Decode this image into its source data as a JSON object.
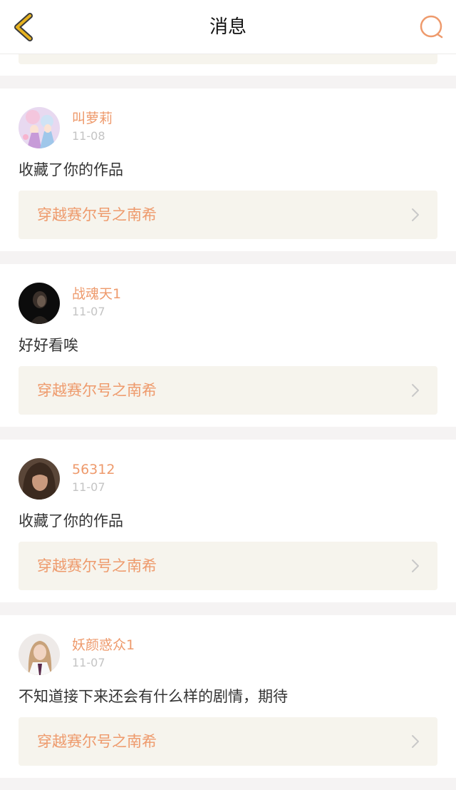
{
  "header": {
    "title": "消息"
  },
  "colors": {
    "accent": "#ee9a6c",
    "back_icon": "#e6b21f",
    "card_link_bg": "#f6f4ed",
    "page_bg": "#f5f3f3"
  },
  "messages": [
    {
      "username": "叫萝莉",
      "date": "11-08",
      "content": "收藏了你的作品",
      "work_title": "穿越赛尔号之南希",
      "avatar_icon": "anime-girl-avatar"
    },
    {
      "username": "战魂天1",
      "date": "11-07",
      "content": "好好看唉",
      "work_title": "穿越赛尔号之南希",
      "avatar_icon": "dark-portrait-avatar"
    },
    {
      "username": "56312",
      "date": "11-07",
      "content": "收藏了你的作品",
      "work_title": "穿越赛尔号之南希",
      "avatar_icon": "brown-hair-avatar"
    },
    {
      "username": "妖颜惑众1",
      "date": "11-07",
      "content": "不知道接下来还会有什么样的剧情，期待",
      "work_title": "穿越赛尔号之南希",
      "avatar_icon": "girl-photo-avatar"
    }
  ]
}
